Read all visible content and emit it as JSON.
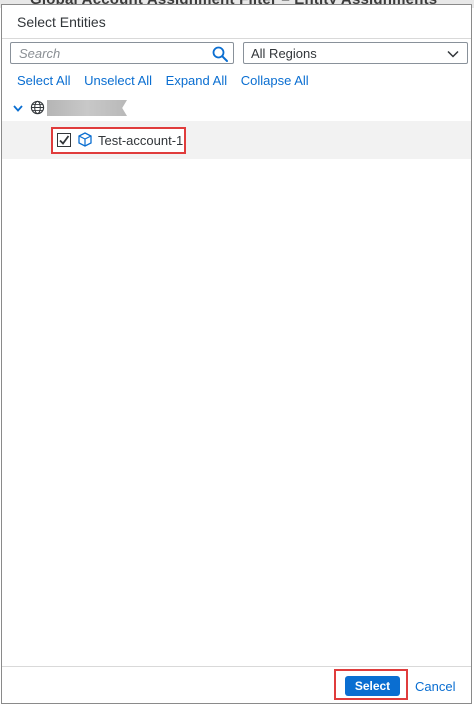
{
  "backdrop": {
    "partial_title": "Global Account Assignment Filter – Entity Assignments"
  },
  "dialog": {
    "title": "Select Entities",
    "search": {
      "placeholder": "Search",
      "value": ""
    },
    "region_select": {
      "selected": "All Regions"
    },
    "actions": {
      "select_all": "Select All",
      "unselect_all": "Unselect All",
      "expand_all": "Expand All",
      "collapse_all": "Collapse All"
    },
    "tree": {
      "root": {
        "icon": "globe-icon",
        "expanded": true
      },
      "children": [
        {
          "label": "Test-account-1",
          "checked": true,
          "icon": "cube-icon"
        }
      ]
    },
    "footer": {
      "select_label": "Select",
      "cancel_label": "Cancel"
    }
  },
  "colors": {
    "accent": "#0a6ed1",
    "highlight": "#e03c3c",
    "row_bg": "#f2f2f2"
  }
}
